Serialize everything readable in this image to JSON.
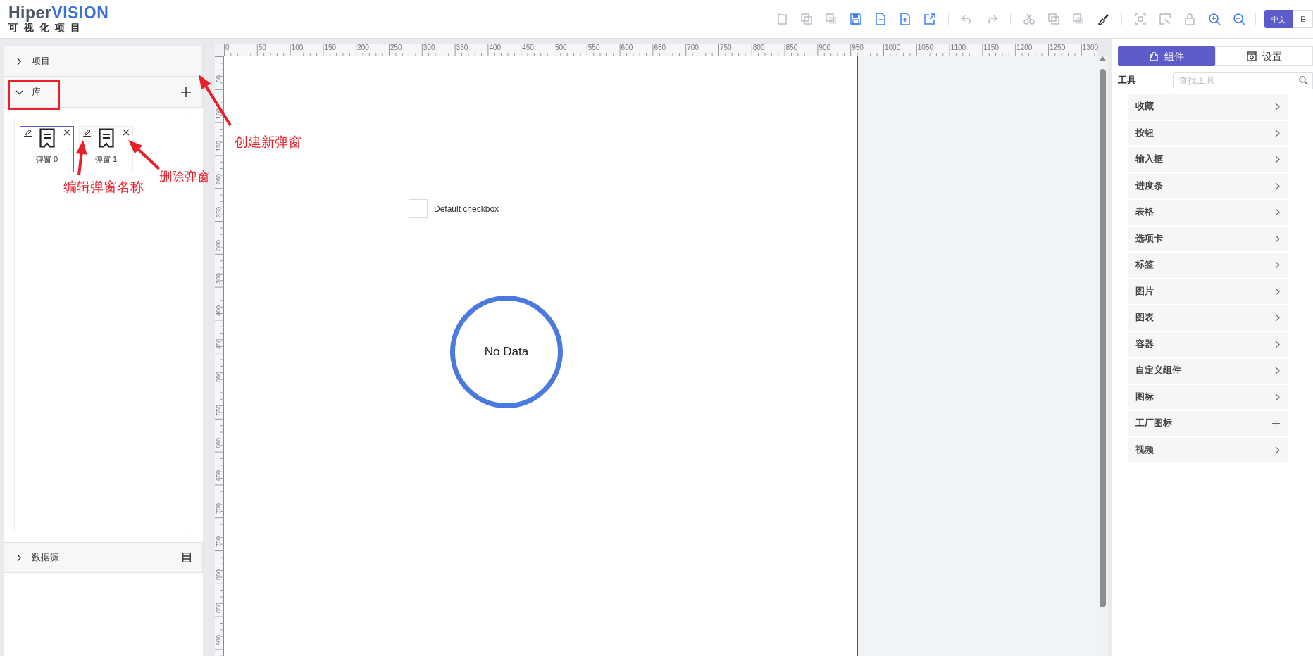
{
  "header": {
    "logo_title": "HiperVISION",
    "logo_subtitle": "可 视 化 项 目",
    "toolbar": [
      {
        "kind": "page",
        "disabled": true
      },
      {
        "kind": "copy",
        "disabled": true
      },
      {
        "kind": "paste",
        "disabled": true
      },
      {
        "kind": "save",
        "disabled": false
      },
      {
        "kind": "file",
        "disabled": false
      },
      {
        "kind": "import",
        "disabled": false
      },
      {
        "kind": "export",
        "disabled": false
      },
      {
        "kind": "undo",
        "disabled": true
      },
      {
        "kind": "redo",
        "disabled": true
      },
      {
        "kind": "cut",
        "disabled": true
      },
      {
        "kind": "copy",
        "disabled": true
      },
      {
        "kind": "paste",
        "disabled": true
      },
      {
        "kind": "brush",
        "disabled": false
      },
      {
        "kind": "group",
        "disabled": true
      },
      {
        "kind": "select",
        "disabled": true
      },
      {
        "kind": "lock",
        "disabled": true
      },
      {
        "kind": "zoom_in",
        "disabled": false
      },
      {
        "kind": "zoom_out",
        "disabled": false
      }
    ],
    "languages": [
      {
        "label": "中文",
        "selected": true
      },
      {
        "label": "E",
        "selected": false
      }
    ]
  },
  "left_panel": {
    "sections": [
      {
        "title": "项目",
        "expanded": false,
        "kind": "plain"
      },
      {
        "title": "库",
        "expanded": true,
        "kind": "add",
        "items": [
          {
            "label": "弹窗 0",
            "selected": true
          },
          {
            "label": "弹窗 1",
            "selected": false
          }
        ]
      },
      {
        "title": "数据源",
        "expanded": false,
        "kind": "list"
      }
    ]
  },
  "annotations": [
    {
      "text": "创建新弹窗"
    },
    {
      "text": "删除弹窗"
    },
    {
      "text": "编辑弹窗名称"
    }
  ],
  "ruler": {
    "x_labels": [
      "0",
      "50",
      "100",
      "150",
      "200",
      "250",
      "300",
      "350",
      "400",
      "450",
      "500",
      "550",
      "600",
      "650",
      "700",
      "750",
      "800",
      "850",
      "900",
      "950",
      "1000",
      "1050",
      "1100",
      "1150",
      "1200",
      "1250",
      "1300"
    ],
    "y_labels": [
      "50",
      "100",
      "150",
      "200",
      "250",
      "300",
      "350",
      "400",
      "450",
      "500",
      "550",
      "600",
      "650",
      "700",
      "750",
      "800",
      "850",
      "900"
    ]
  },
  "canvas": {
    "checkbox": {
      "label": "Default checkbox",
      "checked": false
    },
    "gauge": {
      "label": "No Data"
    }
  },
  "right_panel": {
    "tabs": [
      {
        "label": "组件",
        "selected": true,
        "kind": "puzzle"
      },
      {
        "label": "设置",
        "selected": false,
        "kind": "gear"
      }
    ],
    "tools_label": "工具",
    "search": {
      "placeholder": "查找工具"
    },
    "categories": [
      {
        "label": "收藏",
        "kind": "submenu"
      },
      {
        "label": "按钮",
        "kind": "submenu"
      },
      {
        "label": "输入框",
        "kind": "submenu"
      },
      {
        "label": "进度条",
        "kind": "submenu"
      },
      {
        "label": "表格",
        "kind": "submenu"
      },
      {
        "label": "选项卡",
        "kind": "submenu"
      },
      {
        "label": "标签",
        "kind": "submenu"
      },
      {
        "label": "图片",
        "kind": "submenu"
      },
      {
        "label": "图表",
        "kind": "submenu"
      },
      {
        "label": "容器",
        "kind": "submenu"
      },
      {
        "label": "自定义组件",
        "kind": "submenu"
      },
      {
        "label": "图标",
        "kind": "submenu"
      },
      {
        "label": "工厂图标",
        "kind": "add"
      },
      {
        "label": "视频",
        "kind": "submenu"
      }
    ]
  }
}
